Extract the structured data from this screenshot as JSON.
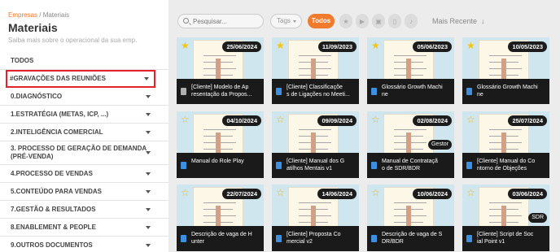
{
  "breadcrumb": {
    "parent": "Empresas",
    "separator": " / ",
    "current": "Materiais"
  },
  "header": {
    "title": "Materiais",
    "subtitle": "Saiba mais sobre o operacional da sua emp."
  },
  "categories": [
    {
      "label": "TODOS"
    },
    {
      "label": "#GRAVAÇÕES DAS REUNIÕES"
    },
    {
      "label": "0.DIAGNÓSTICO"
    },
    {
      "label": "1.ESTRATÉGIA (METAS, ICP, ...)"
    },
    {
      "label": "2.INTELIGÊNCIA COMERCIAL"
    },
    {
      "label": "3. PROCESSO DE GERAÇÃO DE DEMANDA",
      "label2": "(PRÉ-VENDA)"
    },
    {
      "label": "4.PROCESSO DE VENDAS"
    },
    {
      "label": "5.CONTEÚDO PARA VENDAS"
    },
    {
      "label": "7.GESTÃO & RESULTADOS"
    },
    {
      "label": "8.ENABLEMENT & PEOPLE"
    },
    {
      "label": "9.OUTROS DOCUMENTOS"
    }
  ],
  "toolbar": {
    "search_placeholder": "Pesquisar...",
    "tags_label": "Tags",
    "todos_label": "Todos",
    "sort_label": "Mais Recente",
    "sort_arrow": "↓",
    "filters": [
      {
        "icon": "star-icon",
        "glyph": "★"
      },
      {
        "icon": "video-icon",
        "glyph": "▶"
      },
      {
        "icon": "image-icon",
        "glyph": "▣"
      },
      {
        "icon": "file-icon",
        "glyph": "▯"
      },
      {
        "icon": "audio-icon",
        "glyph": "♪"
      }
    ]
  },
  "cards": [
    {
      "date": "25/06/2024",
      "favorite": true,
      "title": "[Cliente] Modelo de Apresentação da Propos...",
      "line1": "[Cliente] Modelo de Ap",
      "line2": "resentação da Propos...",
      "icon": "video-icon",
      "badge": ""
    },
    {
      "date": "11/09/2023",
      "favorite": true,
      "title": "[Cliente] Classificações de Ligações no Meeti...",
      "line1": "[Cliente] Classificaçõe",
      "line2": "s de Ligações no Meeti...",
      "icon": "doc-icon",
      "badge": ""
    },
    {
      "date": "05/06/2023",
      "favorite": true,
      "title": "Glossário Growth Machine",
      "line1": "Glossário Growth Machi",
      "line2": "ne",
      "icon": "doc-icon",
      "badge": ""
    },
    {
      "date": "10/05/2023",
      "favorite": true,
      "title": "Glossário Growth Machine",
      "line1": "Glossário Growth Machi",
      "line2": "ne",
      "icon": "doc-icon",
      "badge": ""
    },
    {
      "date": "04/10/2024",
      "favorite": false,
      "title": "Manual do Role Play",
      "line1": "Manual do Role Play",
      "line2": "",
      "icon": "doc-icon",
      "badge": ""
    },
    {
      "date": "09/09/2024",
      "favorite": false,
      "title": "[Cliente] Manual dos Gatilhos Mentais v1",
      "line1": "[Cliente] Manual dos G",
      "line2": "atilhos Mentais v1",
      "icon": "doc-icon",
      "badge": ""
    },
    {
      "date": "02/08/2024",
      "favorite": false,
      "title": "Manual de Contratação de SDR/BDR",
      "line1": "Manual de Contrataçã",
      "line2": "o de SDR/BDR",
      "icon": "doc-icon",
      "badge": "Gestor"
    },
    {
      "date": "25/07/2024",
      "favorite": false,
      "title": "[Cliente] Manual do Contorno de Objeções",
      "line1": "[Cliente] Manual do Co",
      "line2": "ntorno de Objeções",
      "icon": "doc-icon",
      "badge": ""
    },
    {
      "date": "22/07/2024",
      "favorite": false,
      "title": "Descrição de vaga de Hunter",
      "line1": "Descrição de vaga de H",
      "line2": "unter",
      "icon": "doc-icon",
      "badge": ""
    },
    {
      "date": "14/06/2024",
      "favorite": false,
      "title": "[Cliente] Proposta Comercial v2",
      "line1": "[Cliente] Proposta Co",
      "line2": "mercial v2",
      "icon": "doc-icon",
      "badge": ""
    },
    {
      "date": "10/06/2024",
      "favorite": false,
      "title": "Descrição de vaga de SDR/BDR",
      "line1": "Descrição de vaga de S",
      "line2": "DR/BDR",
      "icon": "doc-icon",
      "badge": ""
    },
    {
      "date": "03/06/2024",
      "favorite": false,
      "title": "[Cliente] Script de Social Point v1",
      "line1": "[Cliente] Script de Soc",
      "line2": "ial Point v1",
      "icon": "doc-icon",
      "badge": "SDR"
    }
  ],
  "colors": {
    "accent": "#f07b2c",
    "highlight": "#e3232c",
    "star": "#f3c613",
    "card_footer": "#1a1a1a",
    "doc_icon": "#3d8fe0"
  }
}
